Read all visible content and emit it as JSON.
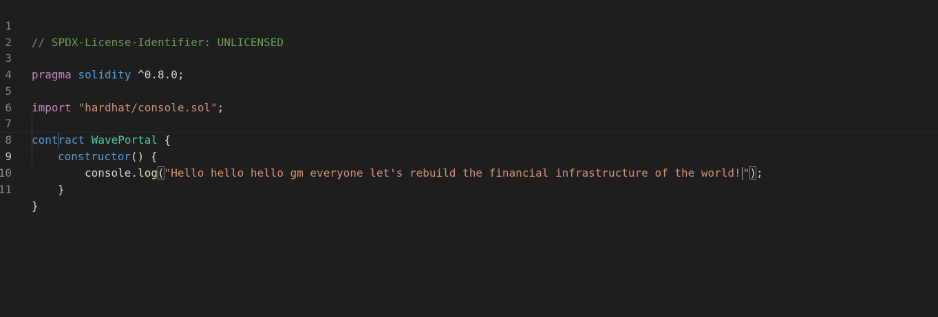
{
  "editor": {
    "colors": {
      "background": "#1e1e1e",
      "comment": "#6a9955",
      "keyword": "#c586c0",
      "storage": "#569cd6",
      "function": "#dcdcaa",
      "string": "#ce9178",
      "type": "#4ec9b0"
    },
    "active_line": 9,
    "line_numbers": [
      "1",
      "2",
      "3",
      "4",
      "5",
      "6",
      "7",
      "8",
      "9",
      "10",
      "11"
    ],
    "lines": {
      "l1": {
        "comment": "// SPDX-License-Identifier: UNLICENSED"
      },
      "l3": {
        "kw": "pragma",
        "name": "solidity",
        "version": "^0.8.0;"
      },
      "l5": {
        "kw": "import",
        "path": "\"hardhat/console.sol\"",
        "semi": ";"
      },
      "l7": {
        "kw": "contract",
        "name": "WavePortal",
        "brace": "{"
      },
      "l8": {
        "kw": "constructor",
        "rest": "() {"
      },
      "l9": {
        "object": "console.",
        "method": "log",
        "open_paren": "(",
        "string_body": "\"Hello hello hello gm everyone let's rebuild the financial infrastructure of the world!",
        "string_end": "\"",
        "close_paren": ")",
        "semi": ";"
      },
      "l10": {
        "brace": "}"
      },
      "l11": {
        "brace": "}"
      }
    }
  }
}
